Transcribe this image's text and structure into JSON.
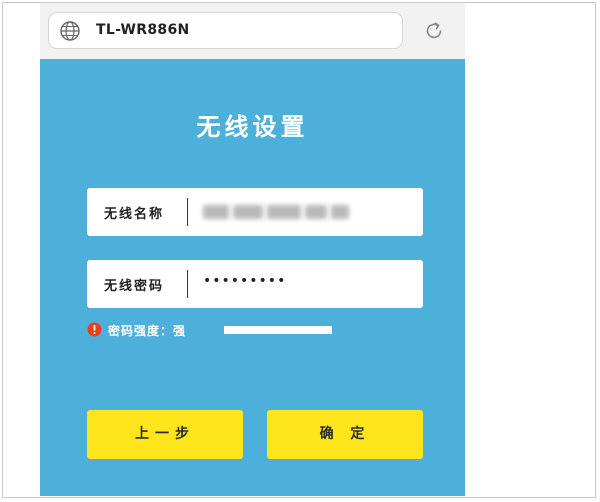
{
  "browser": {
    "url": "TL-WR886N",
    "globe_icon": "globe-icon",
    "reload_icon": "reload-icon"
  },
  "page": {
    "title": "无线设置",
    "ssid": {
      "label": "无线名称",
      "value_obscured": true
    },
    "password": {
      "label": "无线密码",
      "value": "•••••••••"
    },
    "strength": {
      "icon": "warning-icon",
      "label": "密码强度：强",
      "level": 1.0
    },
    "buttons": {
      "prev": "上一步",
      "confirm": "确 定"
    }
  },
  "colors": {
    "background": "#4db0da",
    "button": "#ffe51c",
    "warning": "#e8401c"
  }
}
